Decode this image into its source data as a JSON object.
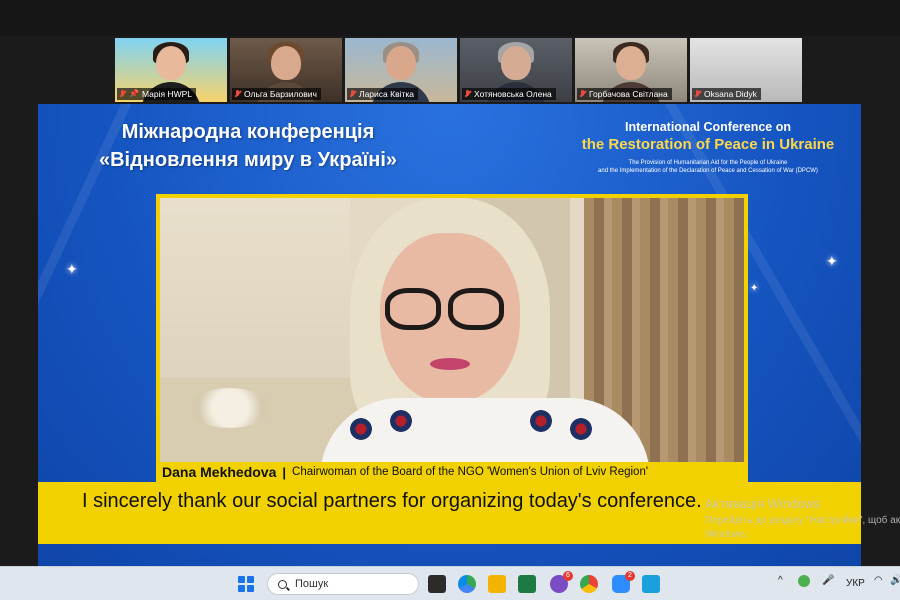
{
  "participants": [
    {
      "name": "Марія HWPL",
      "active": true,
      "pinned": true
    },
    {
      "name": "Ольга Барзилович",
      "active": false,
      "pinned": false
    },
    {
      "name": "Лариса Квітка",
      "active": false,
      "pinned": false
    },
    {
      "name": "Хотяновська Олена",
      "active": false,
      "pinned": false
    },
    {
      "name": "Горбачова Світлана",
      "active": false,
      "pinned": false
    },
    {
      "name": "Oksana Didyk",
      "active": false,
      "pinned": false
    }
  ],
  "slide": {
    "title_ua_line1": "Міжнародна конференція",
    "title_ua_line2": "«Відновлення миру в Україні»",
    "title_en_line1": "International Conference on",
    "title_en_line2": "the Restoration of Peace in Ukraine",
    "title_en_line3": "The Provision of Humanitarian Aid for the People of Ukraine",
    "title_en_line4": "and the Implementation of the Declaration of Peace and Cessation of War (DPCW)"
  },
  "speaker": {
    "name": "Dana Mekhedova",
    "separator": "|",
    "role": "Chairwoman of the Board of the NGO 'Women's Union of Lviv Region'"
  },
  "caption": "I sincerely thank our social partners for organizing today's conference.",
  "watermark": {
    "title": "Активація Windows",
    "line1": "Перейдіть до розділу \"Настройки\", щоб ак",
    "line2": "Windows."
  },
  "taskbar": {
    "search_label": "Пошук",
    "language": "УКР",
    "badges": {
      "viber": "6",
      "zoom": "2"
    }
  },
  "colors": {
    "slide_blue": "#1554c0",
    "banner_yellow": "#f1d100",
    "accent_yellow_text": "#ffd84a",
    "active_tile": "#2ecc71"
  }
}
